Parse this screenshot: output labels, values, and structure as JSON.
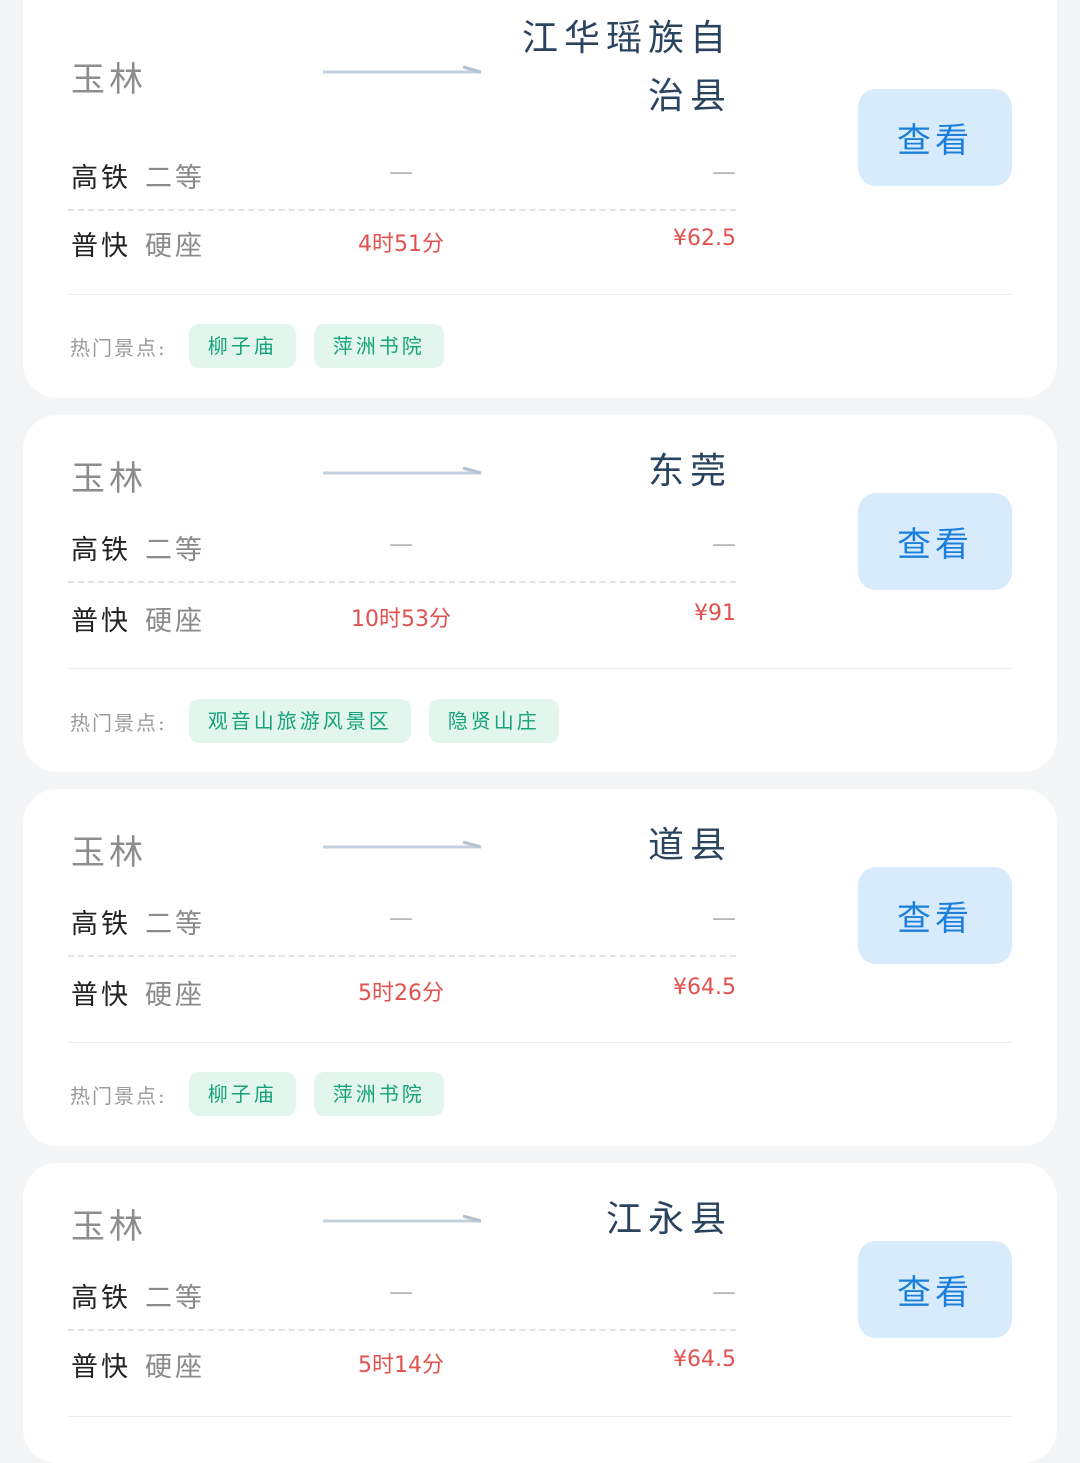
{
  "cards": [
    {
      "from": "玉林",
      "to_lines": [
        "江华瑶族自",
        "治县"
      ],
      "rows": [
        {
          "type": "高铁",
          "seat": "二等",
          "duration": "—",
          "price": "—"
        },
        {
          "type": "普快",
          "seat": "硬座",
          "duration": "4时51分",
          "price": "¥62.5"
        }
      ],
      "button": "查看",
      "spots_label": "热门景点:",
      "spots": [
        "柳子庙",
        "萍洲书院"
      ]
    },
    {
      "from": "玉林",
      "to_lines": [
        "东莞"
      ],
      "rows": [
        {
          "type": "高铁",
          "seat": "二等",
          "duration": "—",
          "price": "—"
        },
        {
          "type": "普快",
          "seat": "硬座",
          "duration": "10时53分",
          "price": "¥91"
        }
      ],
      "button": "查看",
      "spots_label": "热门景点:",
      "spots": [
        "观音山旅游风景区",
        "隐贤山庄"
      ]
    },
    {
      "from": "玉林",
      "to_lines": [
        "道县"
      ],
      "rows": [
        {
          "type": "高铁",
          "seat": "二等",
          "duration": "—",
          "price": "—"
        },
        {
          "type": "普快",
          "seat": "硬座",
          "duration": "5时26分",
          "price": "¥64.5"
        }
      ],
      "button": "查看",
      "spots_label": "热门景点:",
      "spots": [
        "柳子庙",
        "萍洲书院"
      ]
    },
    {
      "from": "玉林",
      "to_lines": [
        "江永县"
      ],
      "rows": [
        {
          "type": "高铁",
          "seat": "二等",
          "duration": "—",
          "price": "—"
        },
        {
          "type": "普快",
          "seat": "硬座",
          "duration": "5时14分",
          "price": "¥64.5"
        }
      ],
      "button": "查看",
      "spots_label": "",
      "spots": []
    }
  ]
}
